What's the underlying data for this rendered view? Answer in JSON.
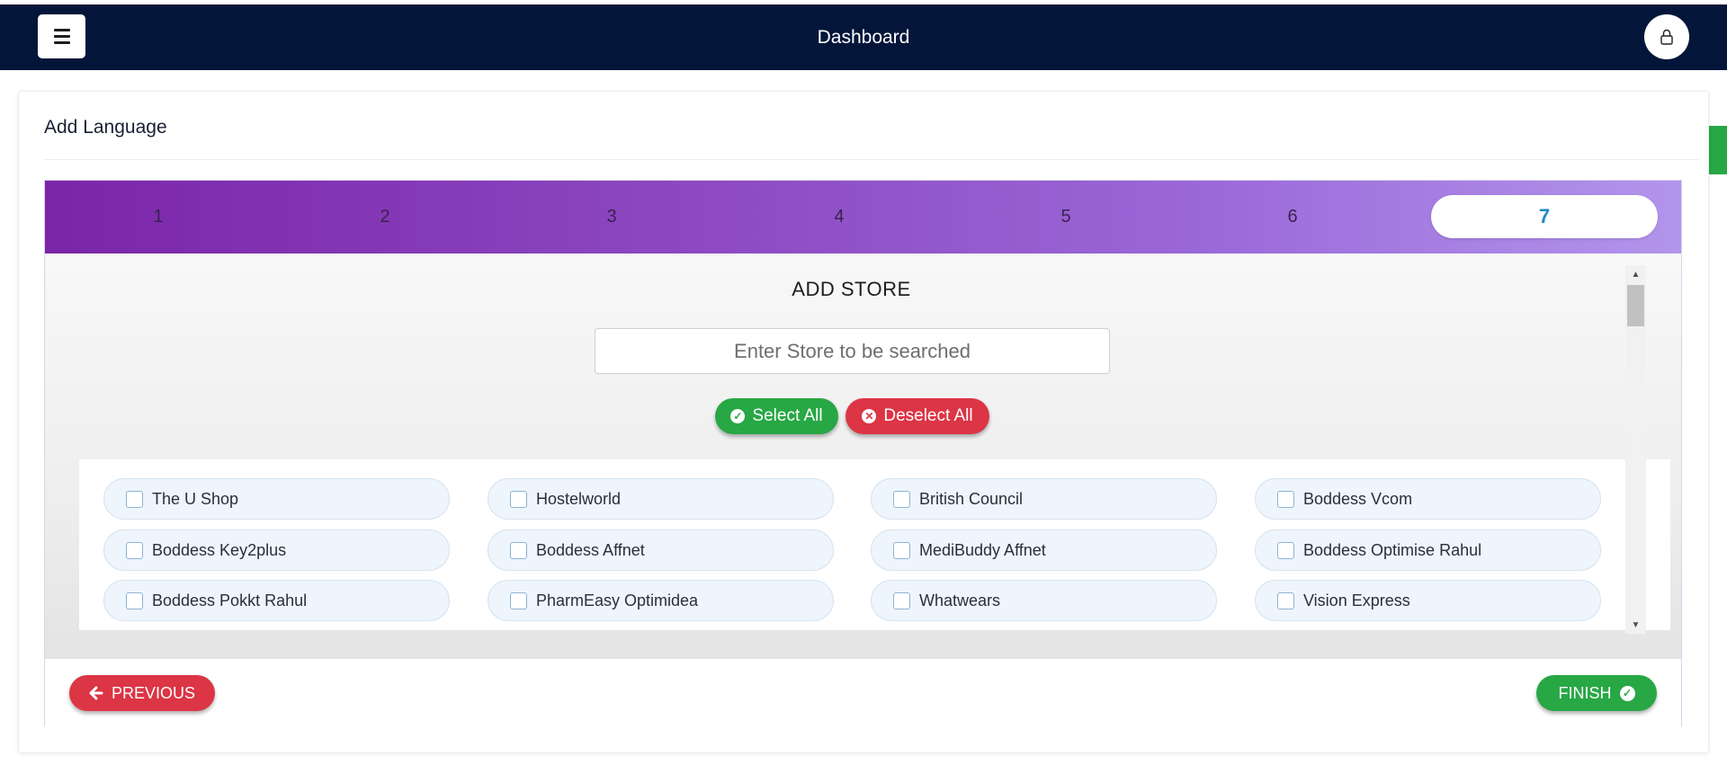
{
  "navbar": {
    "title": "Dashboard",
    "menu_icon": "hamburger-menu-icon",
    "user_icon": "user-lock-icon",
    "background": "#03163a"
  },
  "card": {
    "title": "Add Language",
    "settings_icon": "gear-icon"
  },
  "wizard": {
    "steps": [
      "1",
      "2",
      "3",
      "4",
      "5",
      "6",
      "7"
    ],
    "active_step": "7",
    "section_title": "ADD STORE",
    "search": {
      "placeholder": "Enter Store to be searched",
      "value": ""
    },
    "select_all_label": "Select All",
    "deselect_all_label": "Deselect All",
    "stores": [
      {
        "name": "The U Shop",
        "checked": false
      },
      {
        "name": "Hostelworld",
        "checked": false
      },
      {
        "name": "British Council",
        "checked": false
      },
      {
        "name": "Boddess Vcom",
        "checked": false
      },
      {
        "name": "Boddess Key2plus",
        "checked": false
      },
      {
        "name": "Boddess Affnet",
        "checked": false
      },
      {
        "name": "MediBuddy Affnet",
        "checked": false
      },
      {
        "name": "Boddess Optimise Rahul",
        "checked": false
      },
      {
        "name": "Boddess Pokkt Rahul",
        "checked": false
      },
      {
        "name": "PharmEasy Optimidea",
        "checked": false
      },
      {
        "name": "Whatwears",
        "checked": false
      },
      {
        "name": "Vision Express",
        "checked": false
      }
    ],
    "previous_label": "PREVIOUS",
    "finish_label": "FINISH"
  },
  "colors": {
    "success": "#28a745",
    "danger": "#dc3545",
    "active_step_text": "#1a8ac8"
  }
}
